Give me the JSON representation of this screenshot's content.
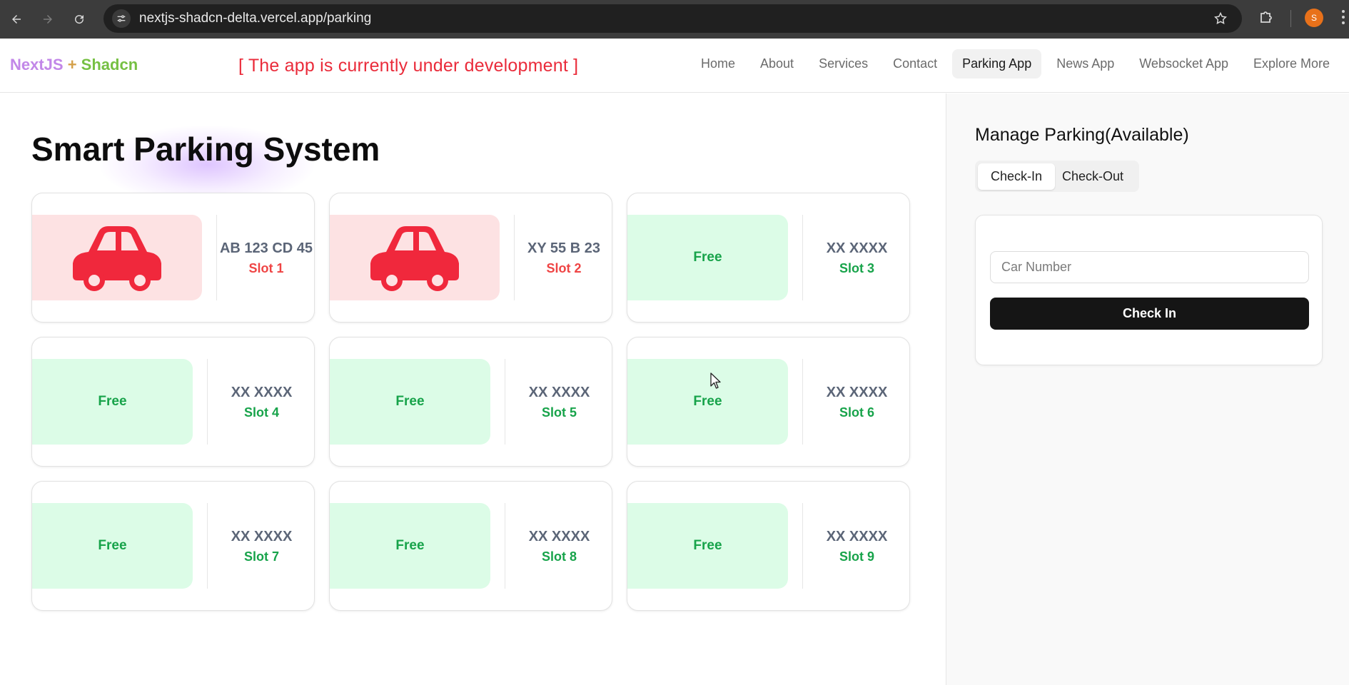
{
  "browser": {
    "url": "nextjs-shadcn-delta.vercel.app/parking",
    "profile_initial": "S"
  },
  "header": {
    "brand_part1": "NextJS",
    "brand_plus": " + ",
    "brand_part2": "Shadcn",
    "dev_notice": "[ The app is currently under development ]",
    "nav": [
      {
        "label": "Home"
      },
      {
        "label": "About"
      },
      {
        "label": "Services"
      },
      {
        "label": "Contact"
      },
      {
        "label": "Parking App",
        "active": true
      },
      {
        "label": "News App"
      },
      {
        "label": "Websocket App"
      },
      {
        "label": "Explore More"
      }
    ]
  },
  "main": {
    "title": "Smart Parking System",
    "slots": [
      {
        "status": "occupied",
        "plate": "AB 123 CD 45",
        "slot": "Slot 1"
      },
      {
        "status": "occupied",
        "plate": "XY 55 B 23",
        "slot": "Slot 2"
      },
      {
        "status": "free",
        "free_label": "Free",
        "plate": "XX XXXX",
        "slot": "Slot 3"
      },
      {
        "status": "free",
        "free_label": "Free",
        "plate": "XX XXXX",
        "slot": "Slot 4"
      },
      {
        "status": "free",
        "free_label": "Free",
        "plate": "XX XXXX",
        "slot": "Slot 5"
      },
      {
        "status": "free",
        "free_label": "Free",
        "plate": "XX XXXX",
        "slot": "Slot 6"
      },
      {
        "status": "free",
        "free_label": "Free",
        "plate": "XX XXXX",
        "slot": "Slot 7"
      },
      {
        "status": "free",
        "free_label": "Free",
        "plate": "XX XXXX",
        "slot": "Slot 8"
      },
      {
        "status": "free",
        "free_label": "Free",
        "plate": "XX XXXX",
        "slot": "Slot 9"
      }
    ]
  },
  "panel": {
    "heading": "Manage Parking(Available)",
    "tabs": [
      {
        "label": "Check-In",
        "active": true
      },
      {
        "label": "Check-Out"
      }
    ],
    "input_placeholder": "Car Number",
    "input_value": "",
    "submit_label": "Check In"
  },
  "colors": {
    "occupied_bg": "#fde2e3",
    "occupied_icon": "#f0283c",
    "free_bg": "#dcfce7",
    "free_text": "#17a34a",
    "dev_notice": "#ea2b3a"
  }
}
